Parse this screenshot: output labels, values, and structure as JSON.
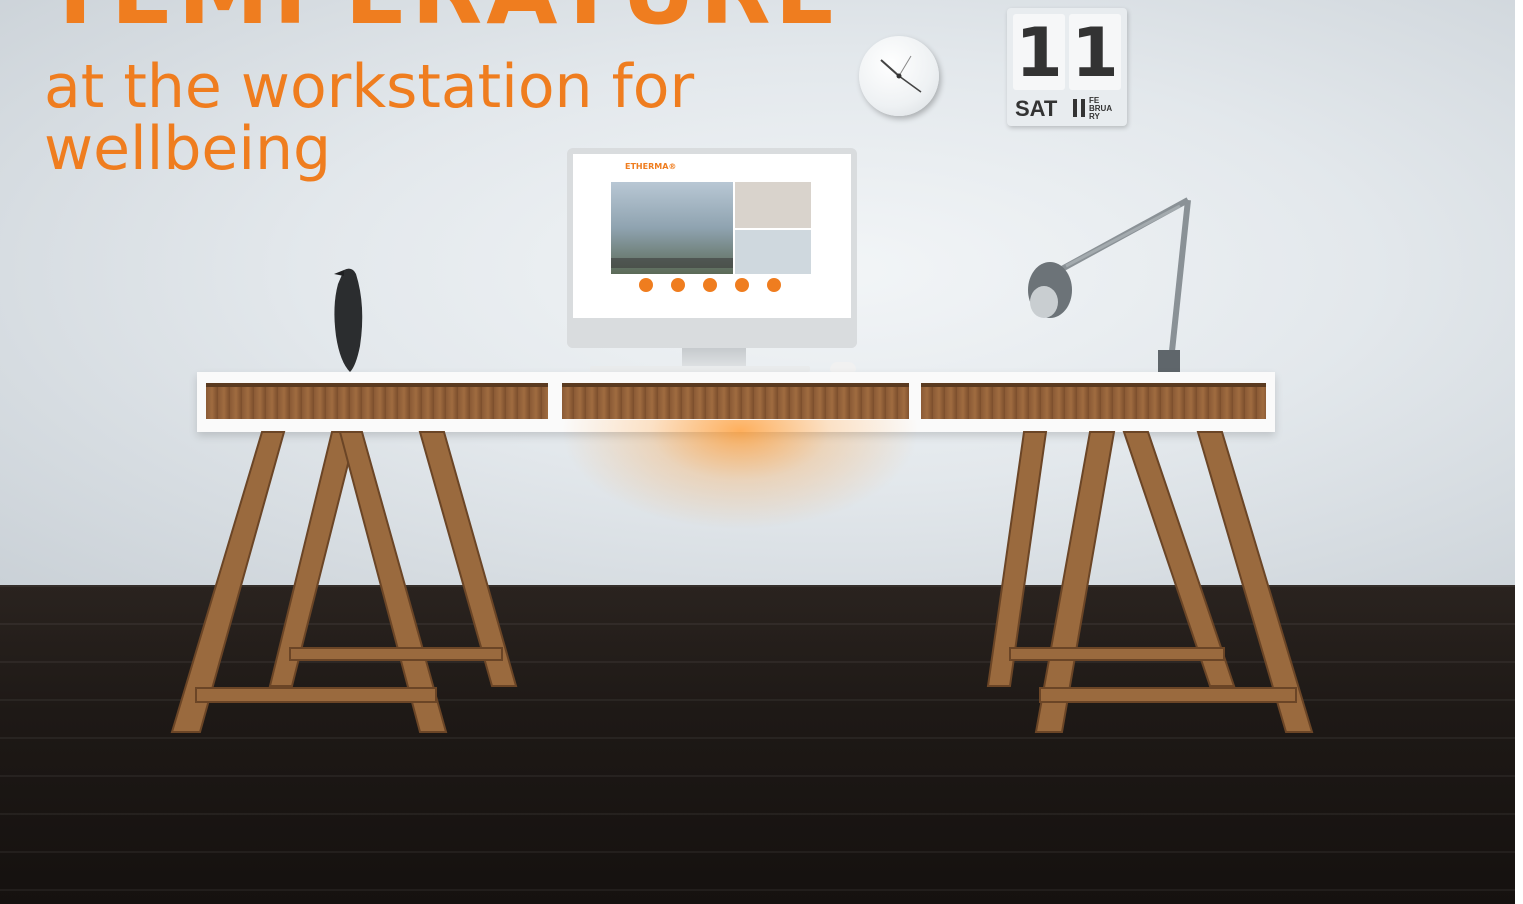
{
  "headline": {
    "title": "TEMPERATURE",
    "subtitle": "at the workstation for wellbeing"
  },
  "calendar": {
    "day_number_tens": "1",
    "day_number_ones": "1",
    "weekday": "SAT",
    "month": "FE BRUA RY"
  },
  "monitor_screen": {
    "brand": "ETHERMA®"
  },
  "colors": {
    "accent": "#ef7d1f",
    "wall": "#e3e8ec",
    "floor": "#1e1916",
    "wood": "#8a5a35"
  },
  "icons": [
    "wall-clock-icon",
    "desk-lamp-icon",
    "bird-figurine-icon"
  ]
}
